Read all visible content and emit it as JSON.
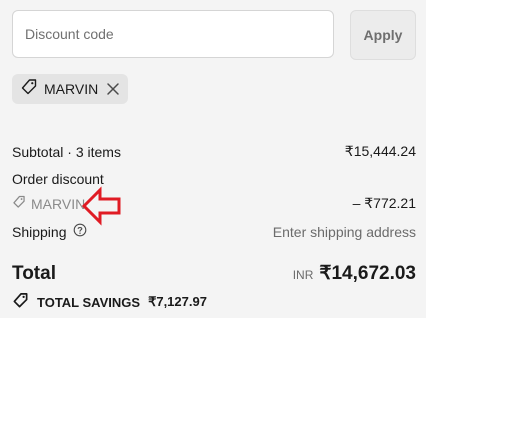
{
  "discount": {
    "placeholder": "Discount code",
    "apply_label": "Apply"
  },
  "applied_code": {
    "label": "MARVIN"
  },
  "summary": {
    "subtotal_label": "Subtotal · 3 items",
    "subtotal_value": "₹15,444.24",
    "order_discount_label": "Order discount",
    "discount_code": "MARVIN",
    "discount_value": "– ₹772.21",
    "shipping_label": "Shipping",
    "shipping_value": "Enter shipping address"
  },
  "total": {
    "label": "Total",
    "currency": "INR",
    "amount": "₹14,672.03"
  },
  "savings": {
    "label": "TOTAL SAVINGS",
    "amount": "₹7,127.97"
  },
  "colors": {
    "panel_bg": "#f4f4f4",
    "annotation_arrow": "#e01b24"
  }
}
